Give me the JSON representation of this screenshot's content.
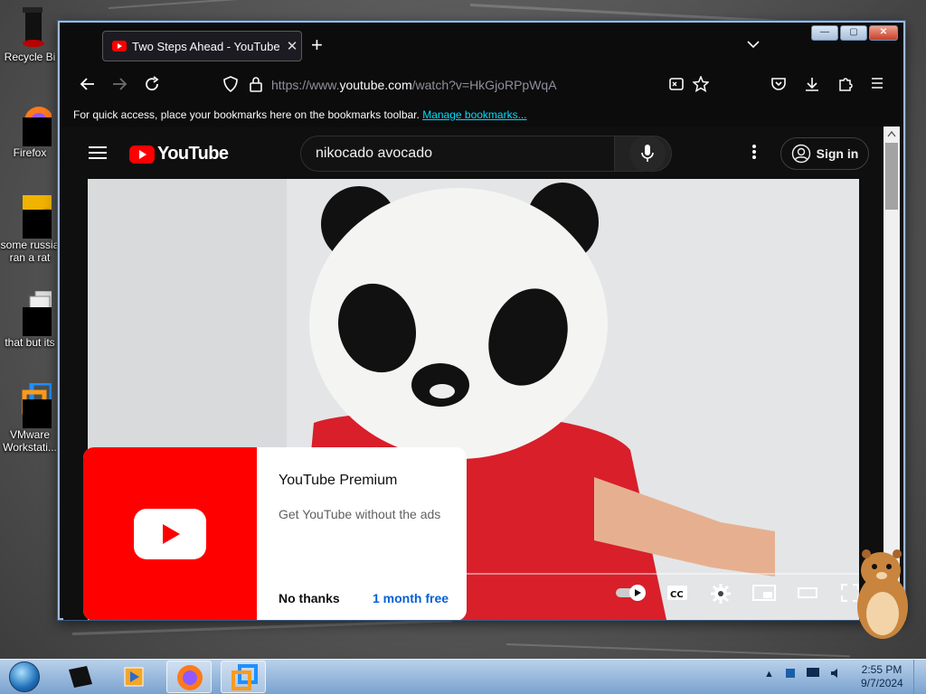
{
  "desktop": {
    "icons": [
      {
        "label": "Recycle Bi",
        "icon": "recycle-bin-icon"
      },
      {
        "label": "Firefox",
        "icon": "firefox-icon"
      },
      {
        "label": "some russia ran a rat",
        "icon": "text-file-icon"
      },
      {
        "label": "that but its",
        "icon": "copy-icon"
      },
      {
        "label": "VMware Workstati...",
        "icon": "vmware-icon"
      }
    ]
  },
  "browser": {
    "tab": {
      "title": "Two Steps Ahead - YouTube",
      "close": "✕"
    },
    "new_tab": "+",
    "tab_list": "⌄",
    "window_buttons": {
      "minimize": "—",
      "maximize": "▢",
      "close": "✕"
    },
    "url_prefix": "https://www.",
    "url_host": "youtube.com",
    "url_path": "/watch?v=HkGjoRPpWqA",
    "bookmarks_text": "For quick access, place your bookmarks here on the bookmarks toolbar.",
    "bookmarks_link": "Manage bookmarks..."
  },
  "youtube": {
    "logo": "YouTube",
    "search_value": "nikocado avocado",
    "sign_in": "Sign in",
    "premium": {
      "title": "YouTube Premium",
      "subtitle": "Get YouTube without the ads",
      "no_thanks": "No thanks",
      "cta": "1 month free"
    },
    "controls": {
      "cc": "CC"
    }
  },
  "taskbar": {
    "time": "2:55 PM",
    "date": "9/7/2024",
    "tray_arrow": "▲"
  },
  "colors": {
    "youtube_red": "#ff0000",
    "link_blue": "#065fd4",
    "bookmark_link": "#00ddff",
    "browser_dark": "#0c0c0c"
  }
}
